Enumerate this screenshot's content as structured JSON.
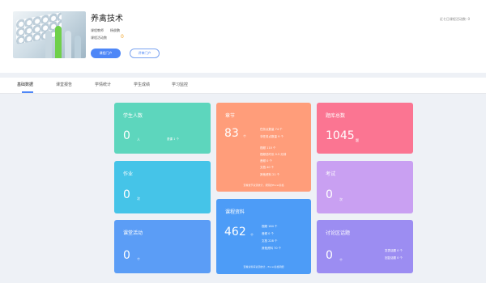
{
  "course": {
    "title": "养禽技术",
    "teacher_label": "课程教师",
    "teacher_name": "杨俊鹏",
    "activity_label": "课程活动数",
    "activity_value": "0",
    "primary_button": "课程门户",
    "secondary_button": "评审门户",
    "recent_activity": "近七日课程活动数: 0"
  },
  "tabs": [
    "基础数据",
    "课堂报告",
    "学情统计",
    "学生成绩",
    "学习监控"
  ],
  "cards": {
    "students": {
      "title": "学生人数",
      "value": "0",
      "unit": "人",
      "sub": "退课 1 个"
    },
    "homework": {
      "title": "作业",
      "value": "0",
      "unit": "次"
    },
    "class_activity": {
      "title": "课堂活动",
      "value": "0",
      "unit": "个"
    },
    "chapters": {
      "title": "章节",
      "value": "83",
      "unit": "个",
      "lines_a": [
        "任务点数量 74 个",
        "非任务点数量 9 个"
      ],
      "lines_b": [
        "视频 110 个",
        "视频总时长 0.5 分钟",
        "音频 0 个",
        "文档 40 个",
        "其他资料 21 个"
      ],
      "foot": "查看章节资源统计，按照的Excel表格"
    },
    "materials": {
      "title": "课程资料",
      "value": "462",
      "unit": "个",
      "lines": [
        "视频 164 个",
        "音频 0 个",
        "文档 228 个",
        "其他资料 70 个"
      ],
      "foot": "查看资料库资源统计，Excel表格明细"
    },
    "question_bank": {
      "title": "题库总数",
      "value": "1045",
      "unit": "题"
    },
    "exam": {
      "title": "考试",
      "value": "0",
      "unit": "次"
    },
    "discussion": {
      "title": "讨论区话题",
      "value": "0",
      "unit": "个",
      "lines": [
        "发表话题 0 个",
        "回复话题 0 个"
      ]
    }
  },
  "colors": {
    "accent": "#4e87f7",
    "students": "#5dd6bd",
    "homework": "#45c4e8",
    "class_activity": "#5b9df6",
    "chapters": "#ff9d7a",
    "materials": "#4d9cf7",
    "question_bank": "#fb7592",
    "exam": "#c9a0f2",
    "discussion": "#9c8df2"
  }
}
